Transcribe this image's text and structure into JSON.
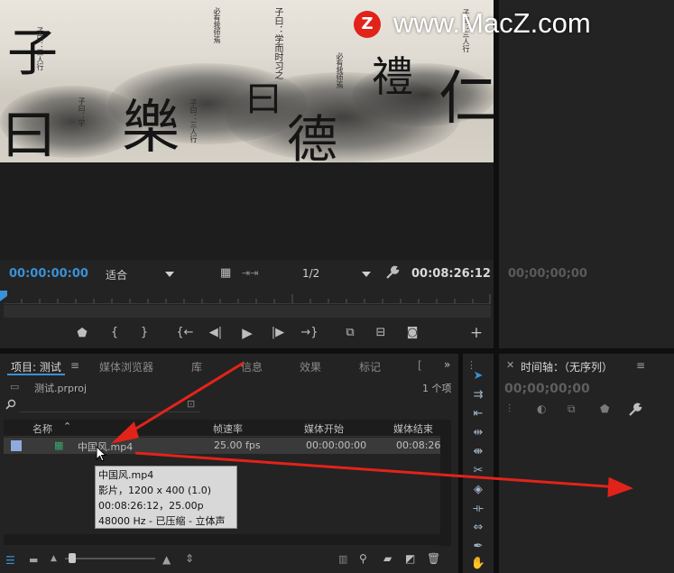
{
  "watermark": {
    "brand": "www.MacZ.com",
    "logo_letter": "Z"
  },
  "program_monitor": {
    "timecode_current": "00:00:00:00",
    "zoom_select": "适合",
    "resolution_select": "1/2",
    "timecode_duration": "00:08:26:12",
    "video_glyphs": [
      "子",
      "曰",
      "樂",
      "禮",
      "仁",
      "德"
    ],
    "video_small_text": [
      "子曰：三人行",
      "子曰：学而时习之",
      "必有我师焉",
      "子曰：学",
      "子曰：三人行"
    ]
  },
  "source_monitor": {
    "timecode": "00;00;00;00"
  },
  "transport": {
    "add_marker": "marker-icon",
    "mark_in": "{",
    "mark_out": "}",
    "go_to_in": "{←",
    "step_back": "◀|",
    "play": "▶",
    "step_forward": "|▶",
    "go_to_out": "→}",
    "add": "+"
  },
  "project_panel": {
    "tabs": [
      "项目: 测试",
      "媒体浏览器",
      "库",
      "信息",
      "效果",
      "标记",
      "["
    ],
    "project_file": "测试.prproj",
    "item_count": "1 个项",
    "columns": [
      "名称",
      "帧速率",
      "媒体开始",
      "媒体结束"
    ],
    "rows": [
      {
        "name": "中国风.mp4",
        "frame_rate": "25.00 fps",
        "media_start": "00:00:00:00",
        "media_end": "00:08:26:"
      }
    ],
    "tooltip": [
      "中国风.mp4",
      "影片，1200 x 400 (1.0)",
      "00:08:26:12，25.00p",
      "48000 Hz - 已压缩 - 立体声"
    ]
  },
  "timeline_panel": {
    "title": "时间轴：（无序列）",
    "timecode": "00;00;00;00"
  },
  "colors": {
    "accent_blue": "#3a91d4",
    "panel_bg": "#232323",
    "arrow_red": "#e2231a"
  }
}
